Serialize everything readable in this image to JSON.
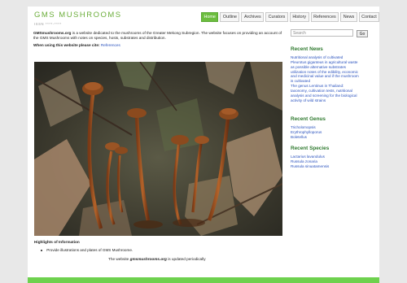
{
  "site": {
    "title": "GMS MUSHROOMS",
    "issn": "ISSN ****-****"
  },
  "nav": [
    {
      "label": "Home",
      "active": true
    },
    {
      "label": "Outline"
    },
    {
      "label": "Archives"
    },
    {
      "label": "Curators"
    },
    {
      "label": "History"
    },
    {
      "label": "References"
    },
    {
      "label": "News"
    },
    {
      "label": "Contact"
    }
  ],
  "intro": {
    "site_name": "GMSmushrooms.org",
    "text": " is a website dedicated to the mushrooms of the Greater Mekong Subregion. The website focuses on providing an account of the GMS Mushrooms with notes on species, hosts, substrates and distribution."
  },
  "cite": {
    "label": "When using this website please cite:",
    "link": "References"
  },
  "highlights": {
    "title": "Highlights of Information",
    "items": [
      "Provide illustrations and plates of GMS Mushroome."
    ]
  },
  "footer_note": {
    "before": "The website ",
    "site": "gmsmushrooms.org",
    "after": " is updated periodically"
  },
  "search": {
    "placeholder": "Search",
    "button": "Go"
  },
  "recent_news": {
    "title": "Recent News",
    "items": [
      "Nutritional analysis of cultivated",
      "Pleurotus giganteus in agricultural waste",
      "as possible alternative substrates",
      "utilization notes of the edibility, economic",
      "and medicinal value and if the mushroom",
      "is cultivated",
      "The genus Lentinus in Thailand:",
      "taxonomy, cultivation tests, nutritional",
      "analysis and screening for the biological",
      "activity of wild strains"
    ]
  },
  "recent_genus": {
    "title": "Recent Genus",
    "items": [
      "Tricholomopsis",
      "Erythrophylloporus",
      "Boletellus"
    ]
  },
  "recent_species": {
    "title": "Recent Species",
    "items": [
      "Lactarius lavandulus",
      "Russula zonaria",
      "Russula sinuatamensis"
    ]
  },
  "colors": {
    "accent": "#6cbd3f",
    "heading": "#2f7a2f",
    "link": "#2a52be"
  }
}
